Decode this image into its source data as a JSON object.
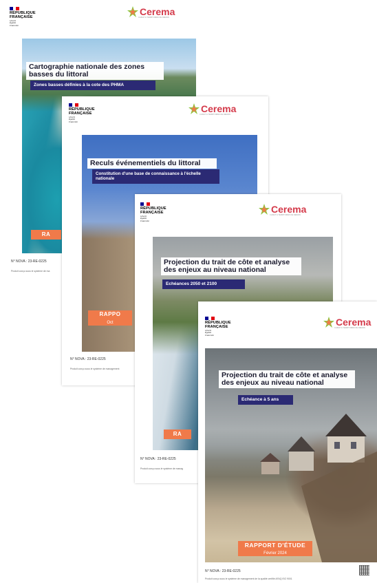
{
  "covers": [
    {
      "republique": [
        "RÉPUBLIQUE",
        "FRANÇAISE"
      ],
      "motto": [
        "Liberté",
        "Égalité",
        "Fraternité"
      ],
      "brand": "Cerema",
      "brand_tagline": "CLIMAT & TERRITOIRES DE DEMAIN",
      "title": "Cartographie nationale des zones basses du littoral",
      "subtitle": "Zones basses définies à la cote des PHMA",
      "band": "RA",
      "nova": "N° NOVA : 23-RE-0225",
      "fine_print": "Produit conçu sous le système de ma"
    },
    {
      "republique": [
        "RÉPUBLIQUE",
        "FRANÇAISE"
      ],
      "motto": [
        "Liberté",
        "Égalité",
        "Fraternité"
      ],
      "brand": "Cerema",
      "brand_tagline": "CLIMAT & TERRITOIRES DE DEMAIN",
      "title": "Reculs événementiels du littoral",
      "subtitle": "Constitution d'une base de connaissance à l'échelle nationale",
      "band": "RAPPO",
      "band_date": "Oct",
      "nova": "N° NOVA : 23-RE-0225",
      "fine_print": "Produit conçu sous le système de management"
    },
    {
      "republique": [
        "RÉPUBLIQUE",
        "FRANÇAISE"
      ],
      "motto": [
        "Liberté",
        "Égalité",
        "Fraternité"
      ],
      "brand": "Cerema",
      "brand_tagline": "CLIMAT & TERRITOIRES DE DEMAIN",
      "title": "Projection du trait de côte et analyse des enjeux au niveau national",
      "subtitle": "Echéances 2050 et 2100",
      "band": "RA",
      "nova": "N° NOVA : 23-RE-0225",
      "fine_print": "Produit conçu sous le système de manag"
    },
    {
      "republique": [
        "RÉPUBLIQUE",
        "FRANÇAISE"
      ],
      "motto": [
        "Liberté",
        "Égalité",
        "Fraternité"
      ],
      "brand": "Cerema",
      "brand_tagline": "CLIMAT & TERRITOIRES DE DEMAIN",
      "title": "Projection du trait de côte et analyse des enjeux au niveau national",
      "subtitle": "Echéance à 5 ans",
      "band": "RAPPORT D'ÉTUDE",
      "band_date": "Février 2024",
      "nova": "N° NOVA : 23-RE-0225",
      "fine_print": "Produit conçu sous le système de management de la qualité certifié AFAQ ISO 9001"
    }
  ],
  "colors": {
    "rf_blue": "#000091",
    "rf_red": "#e1000f",
    "cerema_red": "#d43a4a",
    "subtitle_bg": "#2b2a74",
    "band_orange": "#f07a4a"
  }
}
